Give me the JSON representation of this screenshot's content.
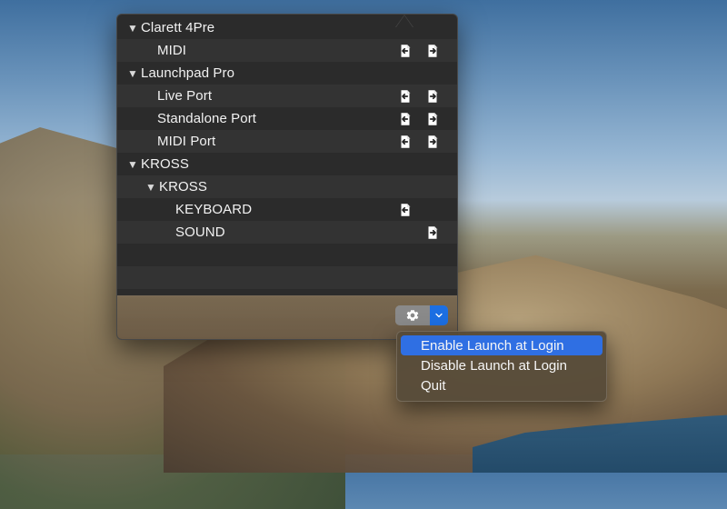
{
  "devices": [
    {
      "name": "Clarett 4Pre",
      "expanded": true,
      "ports": [
        {
          "label": "MIDI",
          "input": true,
          "output": true
        }
      ]
    },
    {
      "name": "Launchpad Pro",
      "expanded": true,
      "ports": [
        {
          "label": "Live Port",
          "input": true,
          "output": true
        },
        {
          "label": "Standalone Port",
          "input": true,
          "output": true
        },
        {
          "label": "MIDI Port",
          "input": true,
          "output": true
        }
      ]
    },
    {
      "name": "KROSS",
      "expanded": true,
      "subgroups": [
        {
          "name": "KROSS",
          "expanded": true,
          "ports": [
            {
              "label": "KEYBOARD",
              "input": true,
              "output": false
            },
            {
              "label": "SOUND",
              "input": false,
              "output": true
            }
          ]
        }
      ]
    }
  ],
  "toolbar": {
    "gear_icon": "gear-icon",
    "dropdown_icon": "chevron-down-icon",
    "accent": "#1c6fe3"
  },
  "menu": {
    "items": [
      {
        "label": "Enable Launch at Login",
        "highlighted": true
      },
      {
        "label": "Disable Launch at Login",
        "highlighted": false
      },
      {
        "label": "Quit",
        "highlighted": false
      }
    ]
  }
}
